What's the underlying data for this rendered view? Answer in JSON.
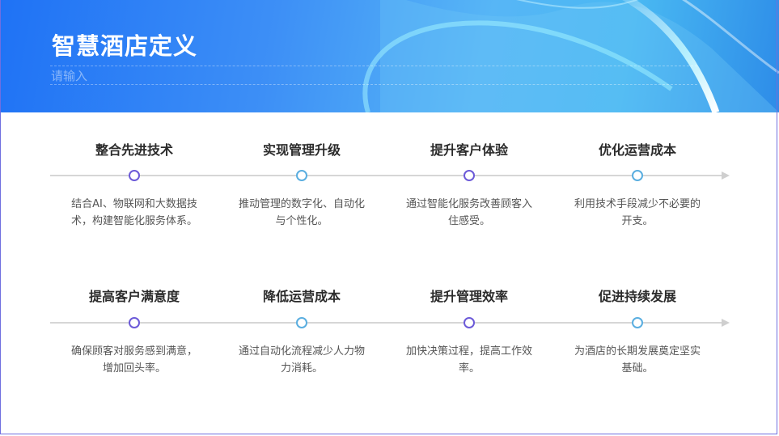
{
  "header": {
    "title": "智慧酒店定义",
    "subtitle_placeholder": "请输入"
  },
  "colors": {
    "node_purple": "#6c5ad8",
    "node_blue": "#5aaee0",
    "line": "#d6d6d6"
  },
  "rows": [
    {
      "items": [
        {
          "title": "整合先进技术",
          "desc": "结合AI、物联网和大数据技术，构建智能化服务体系。",
          "node_color": "purple"
        },
        {
          "title": "实现管理升级",
          "desc": "推动管理的数字化、自动化与个性化。",
          "node_color": "blue"
        },
        {
          "title": "提升客户体验",
          "desc": "通过智能化服务改善顾客入住感受。",
          "node_color": "purple"
        },
        {
          "title": "优化运营成本",
          "desc": "利用技术手段减少不必要的开支。",
          "node_color": "blue"
        }
      ]
    },
    {
      "items": [
        {
          "title": "提高客户满意度",
          "desc": "确保顾客对服务感到满意，增加回头率。",
          "node_color": "purple"
        },
        {
          "title": "降低运营成本",
          "desc": "通过自动化流程减少人力物力消耗。",
          "node_color": "blue"
        },
        {
          "title": "提升管理效率",
          "desc": "加快决策过程，提高工作效率。",
          "node_color": "purple"
        },
        {
          "title": "促进持续发展",
          "desc": "为酒店的长期发展奠定坚实基础。",
          "node_color": "blue"
        }
      ]
    }
  ]
}
